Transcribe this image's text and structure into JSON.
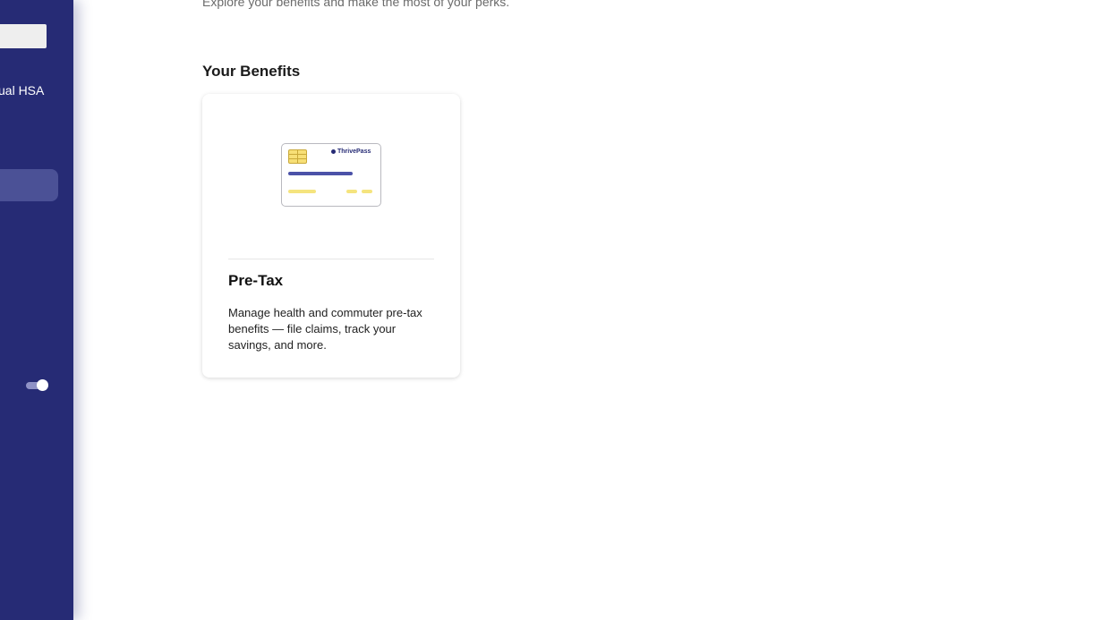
{
  "sidebar": {
    "item_label": "ual HSA"
  },
  "main": {
    "subtitle": "Explore your benefits and make the most of your perks.",
    "section_title": "Your Benefits",
    "cards": [
      {
        "illustration_brand": "ThrivePass",
        "title": "Pre-Tax",
        "description": "Manage health and commuter pre-tax benefits — file claims, track your savings, and more."
      }
    ]
  },
  "colors": {
    "sidebar_bg": "#262b75",
    "sidebar_active": "#4b5196",
    "accent_blue": "#4b52a8",
    "accent_yellow": "#f5e47e"
  },
  "icons": {
    "toggle": "toggle-switch-icon",
    "card_illustration": "credit-card-icon"
  }
}
